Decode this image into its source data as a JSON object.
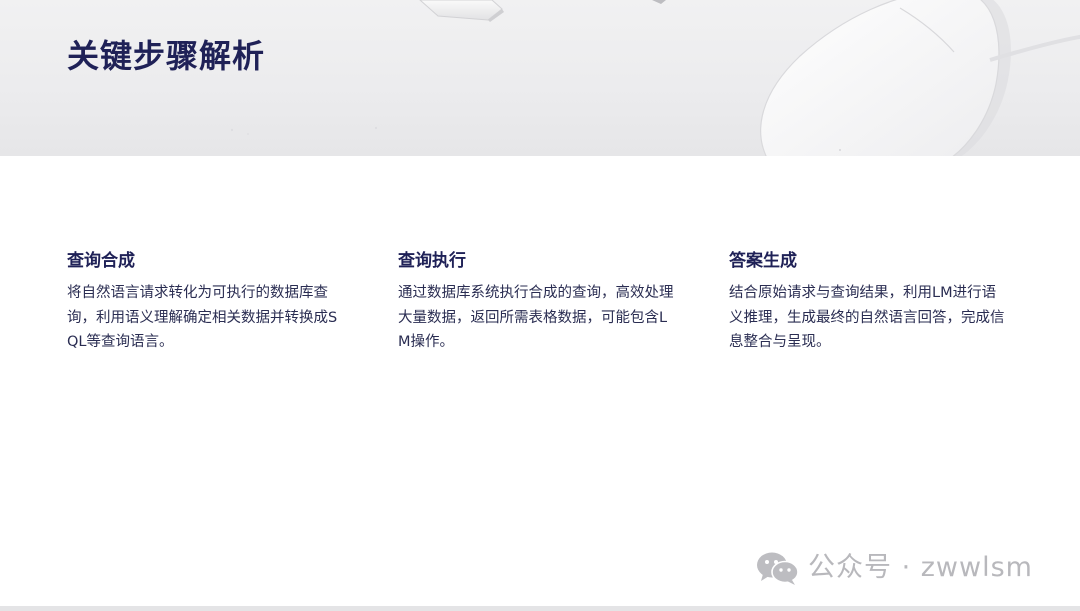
{
  "header": {
    "title": "关键步骤解析"
  },
  "steps": [
    {
      "title": "查询合成",
      "description": "将自然语言请求转化为可执行的数据库查询，利用语义理解确定相关数据并转换成SQL等查询语言。"
    },
    {
      "title": "查询执行",
      "description": "通过数据库系统执行合成的查询，高效处理大量数据，返回所需表格数据，可能包含LM操作。"
    },
    {
      "title": "答案生成",
      "description": "结合原始请求与查询结果，利用LM进行语义推理，生成最终的自然语言回答，完成信息整合与呈现。"
    }
  ],
  "watermark": {
    "text": "公众号 · zwwlsm",
    "icon": "wechat-icon"
  },
  "colors": {
    "title": "#1f2157",
    "body_text": "#2a2d52",
    "hero_background": "#eeeeef",
    "watermark": "#b8b8bc"
  }
}
